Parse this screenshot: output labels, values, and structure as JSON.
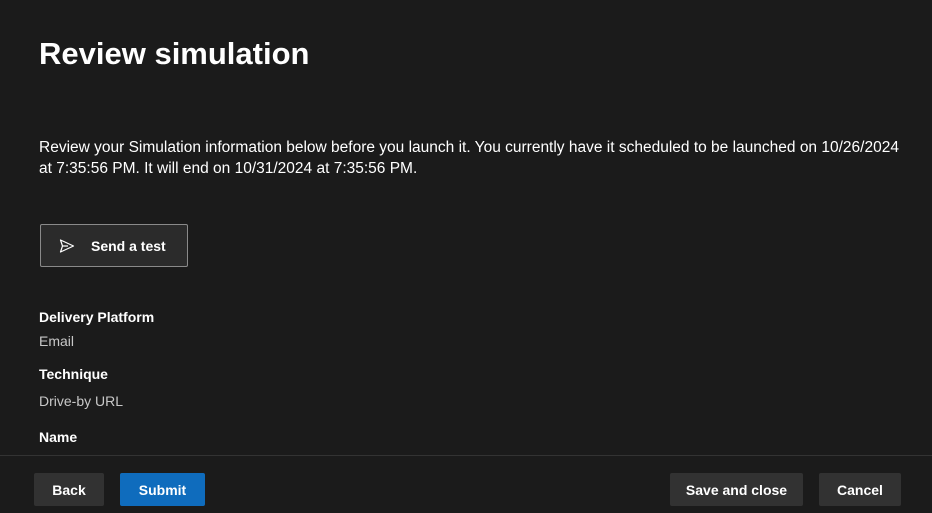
{
  "page": {
    "title": "Review simulation",
    "description": "Review your Simulation information below before you launch it. You currently have it scheduled to be launched on 10/26/2024 at 7:35:56 PM. It will end on 10/31/2024 at 7:35:56 PM."
  },
  "send_test": {
    "label": "Send a test",
    "icon": "send-icon"
  },
  "details": {
    "delivery_platform": {
      "label": "Delivery Platform",
      "value": "Email"
    },
    "technique": {
      "label": "Technique",
      "value": "Drive-by URL"
    },
    "name": {
      "label": "Name"
    }
  },
  "footer": {
    "back_label": "Back",
    "submit_label": "Submit",
    "save_close_label": "Save and close",
    "cancel_label": "Cancel"
  },
  "colors": {
    "background": "#1b1b1b",
    "primary": "#0f6cbd",
    "secondary_button": "#323232",
    "muted_text": "#c8c8c8"
  }
}
